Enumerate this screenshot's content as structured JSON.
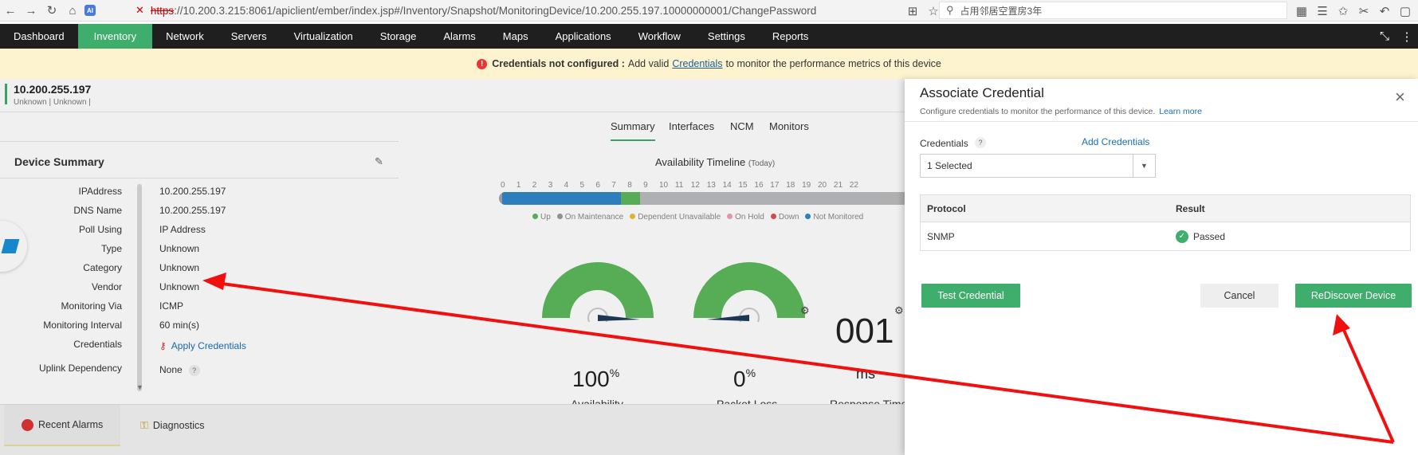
{
  "browser": {
    "tab_icon": "AI",
    "url_scheme": "https",
    "url_rest": "://10.200.3.215:8061/apiclient/ember/index.jsp#/Inventory/Snapshot/MonitoringDevice/10.200.255.197.10000000001/ChangePassword",
    "search_text": "占用邻居空置房3年"
  },
  "nav": {
    "items": [
      "Dashboard",
      "Inventory",
      "Network",
      "Servers",
      "Virtualization",
      "Storage",
      "Alarms",
      "Maps",
      "Applications",
      "Workflow",
      "Settings",
      "Reports"
    ],
    "active_index": 1,
    "accent": "#3fad6c"
  },
  "banner": {
    "bold": "Credentials not configured :",
    "text_before": "Add valid",
    "link": "Credentials",
    "text_after": "to monitor the performance metrics of this device"
  },
  "device": {
    "ip": "10.200.255.197",
    "sub": "Unknown | Unknown |"
  },
  "tabs": [
    "Summary",
    "Interfaces",
    "NCM",
    "Monitors"
  ],
  "summary": {
    "title": "Device Summary",
    "rows": [
      {
        "k": "IPAddress",
        "v": "10.200.255.197"
      },
      {
        "k": "DNS Name",
        "v": "10.200.255.197"
      },
      {
        "k": "Poll Using",
        "v": "IP Address"
      },
      {
        "k": "Type",
        "v": "Unknown"
      },
      {
        "k": "Category",
        "v": "Unknown"
      },
      {
        "k": "Vendor",
        "v": "Unknown"
      },
      {
        "k": "Monitoring Via",
        "v": "ICMP"
      },
      {
        "k": "Monitoring Interval",
        "v": "60 min(s)"
      },
      {
        "k": "Credentials",
        "v": "Apply Credentials"
      },
      {
        "k": "Uplink Dependency",
        "v": "None"
      }
    ],
    "q_mark": "?"
  },
  "timeline": {
    "title": "Availability Timeline",
    "title_small": "(Today)",
    "hours": [
      "0",
      "1",
      "2",
      "3",
      "4",
      "5",
      "6",
      "7",
      "8",
      "9",
      "10",
      "11",
      "12",
      "13",
      "14",
      "15",
      "16",
      "17",
      "18",
      "19",
      "20",
      "21",
      "22"
    ],
    "segments": [
      {
        "from": 0,
        "to": 0.2,
        "color": "#9fa6ad"
      },
      {
        "from": 0.2,
        "to": 7.7,
        "color": "#2f86c8"
      },
      {
        "from": 7.7,
        "to": 8.9,
        "color": "#5cb85c"
      },
      {
        "from": 8.9,
        "to": 24,
        "color": "#b9bcbf"
      }
    ],
    "legend": [
      {
        "label": "Up",
        "color": "#5cb85c"
      },
      {
        "label": "On Maintenance",
        "color": "#999999"
      },
      {
        "label": "Dependent Unavailable",
        "color": "#e8c13a"
      },
      {
        "label": "On Hold",
        "color": "#f0a0b0"
      },
      {
        "label": "Down",
        "color": "#e05050"
      },
      {
        "label": "Not Monitored",
        "color": "#2f86c8"
      }
    ]
  },
  "gauges": [
    {
      "value": "100",
      "unit": "%",
      "label": "Availability",
      "level": 1.0
    },
    {
      "value": "0",
      "unit": "%",
      "label": "Packet Loss",
      "level": 0.0
    }
  ],
  "response": {
    "value": "001",
    "unit": "ms",
    "label": "Response Time"
  },
  "bottom_tabs": [
    "Recent Alarms",
    "Diagnostics"
  ],
  "panel": {
    "title": "Associate Credential",
    "subtitle": "Configure credentials to monitor the performance of this device.",
    "learn_more": "Learn more",
    "close": "×",
    "cred_label": "Credentials",
    "cred_q": "?",
    "add_credentials": "Add Credentials",
    "selected": "1 Selected",
    "table_head": [
      "Protocol",
      "Result"
    ],
    "table_rows": [
      {
        "protocol": "SNMP",
        "result": "Passed"
      }
    ],
    "test_button": "Test Credential",
    "cancel_button": "Cancel",
    "rediscover_button": "ReDiscover Device"
  }
}
